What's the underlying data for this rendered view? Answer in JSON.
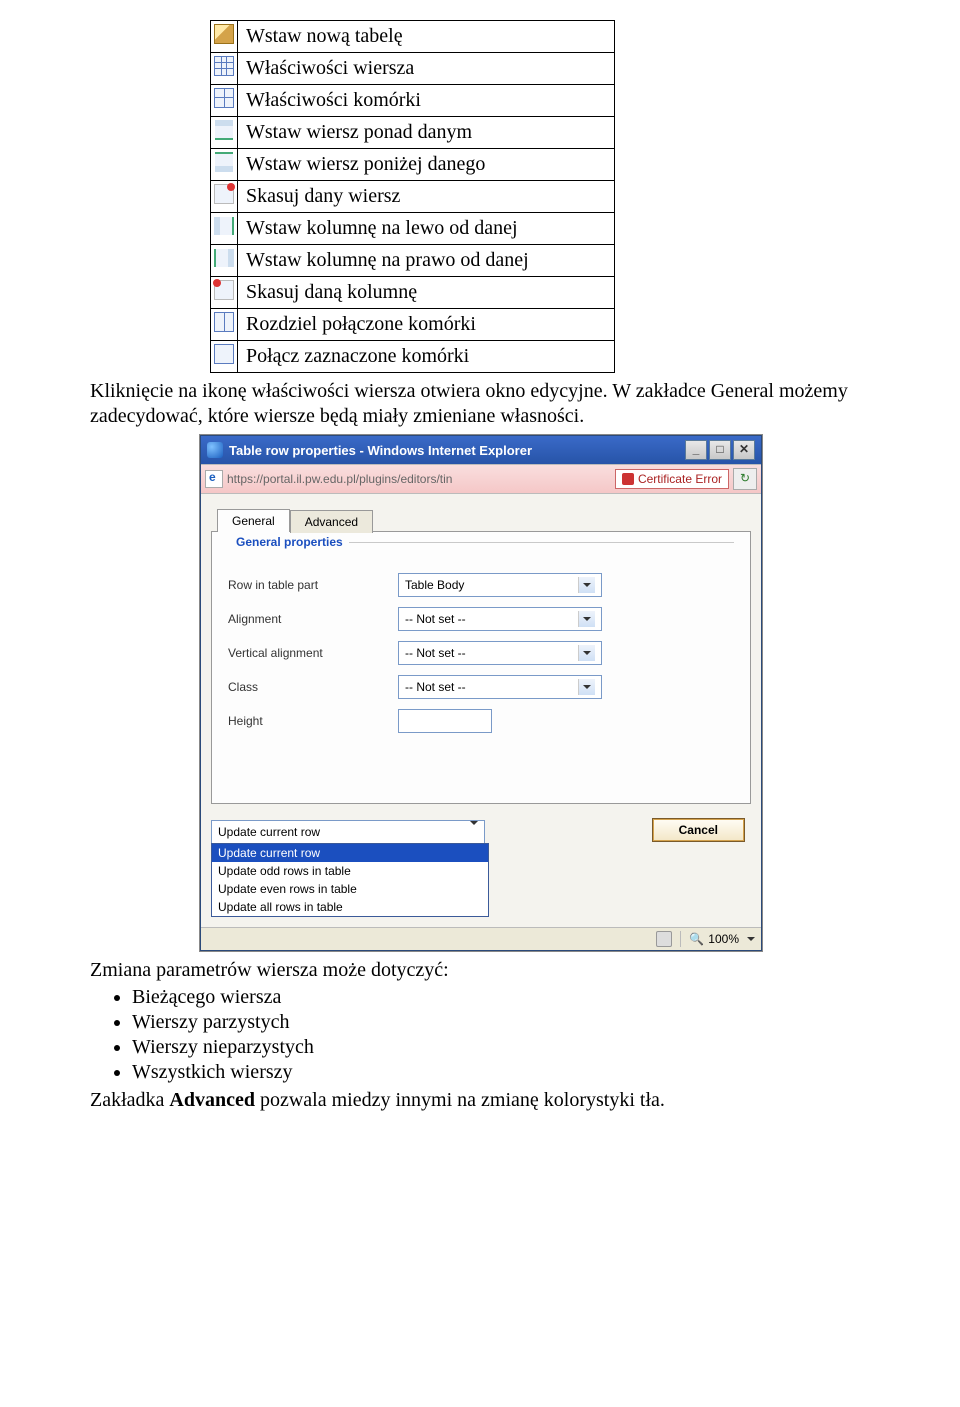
{
  "table_functions": [
    {
      "icon": "ic-pencil",
      "name": "insert-table-icon",
      "label": "Wstaw nową tabelę"
    },
    {
      "icon": "ic-grid",
      "name": "row-properties-icon",
      "label": "Właściwości wiersza"
    },
    {
      "icon": "ic-cell",
      "name": "cell-properties-icon",
      "label": "Właściwości komórki"
    },
    {
      "icon": "ic-row-above",
      "name": "insert-row-above-icon",
      "label": "Wstaw wiersz ponad danym"
    },
    {
      "icon": "ic-row-below",
      "name": "insert-row-below-icon",
      "label": "Wstaw wiersz poniżej danego"
    },
    {
      "icon": "ic-row-del",
      "name": "delete-row-icon",
      "label": "Skasuj dany wiersz"
    },
    {
      "icon": "ic-col-left",
      "name": "insert-col-left-icon",
      "label": "Wstaw kolumnę na lewo od danej"
    },
    {
      "icon": "ic-col-right",
      "name": "insert-col-right-icon",
      "label": "Wstaw kolumnę na prawo od danej"
    },
    {
      "icon": "ic-col-del",
      "name": "delete-col-icon",
      "label": "Skasuj daną kolumnę"
    },
    {
      "icon": "ic-split",
      "name": "split-cells-icon",
      "label": "Rozdziel połączone komórki"
    },
    {
      "icon": "ic-merge",
      "name": "merge-cells-icon",
      "label": "Połącz zaznaczone komórki"
    }
  ],
  "para1": "Kliknięcie na ikonę właściwości wiersza otwiera okno edycyjne. W zakładce General możemy zadecydować, które wiersze będą miały zmieniane własności.",
  "dialog": {
    "title": "Table row properties - Windows Internet Explorer",
    "url": "https://portal.il.pw.edu.pl/plugins/editors/tin",
    "cert": "Certificate Error",
    "tabs": {
      "general": "General",
      "advanced": "Advanced"
    },
    "fieldset": "General properties",
    "rows": {
      "rowpart": {
        "label": "Row in table part",
        "value": "Table Body"
      },
      "align": {
        "label": "Alignment",
        "value": "-- Not set --"
      },
      "valign": {
        "label": "Vertical alignment",
        "value": "-- Not set --"
      },
      "class": {
        "label": "Class",
        "value": "-- Not set --"
      },
      "height": {
        "label": "Height",
        "value": ""
      }
    },
    "scope_select": "Update current row",
    "scope_options": [
      "Update current row",
      "Update odd rows in table",
      "Update even rows in table",
      "Update all rows in table"
    ],
    "cancel": "Cancel",
    "zoom": "100%"
  },
  "para2": "Zmiana parametrów wiersza może dotyczyć:",
  "bullets": [
    "Bieżącego wiersza",
    "Wierszy parzystych",
    "Wierszy nieparzystych",
    "Wszystkich wierszy"
  ],
  "para3_prefix": "Zakładka ",
  "para3_bold": "Advanced",
  "para3_suffix": " pozwala miedzy innymi na zmianę kolorystyki tła."
}
